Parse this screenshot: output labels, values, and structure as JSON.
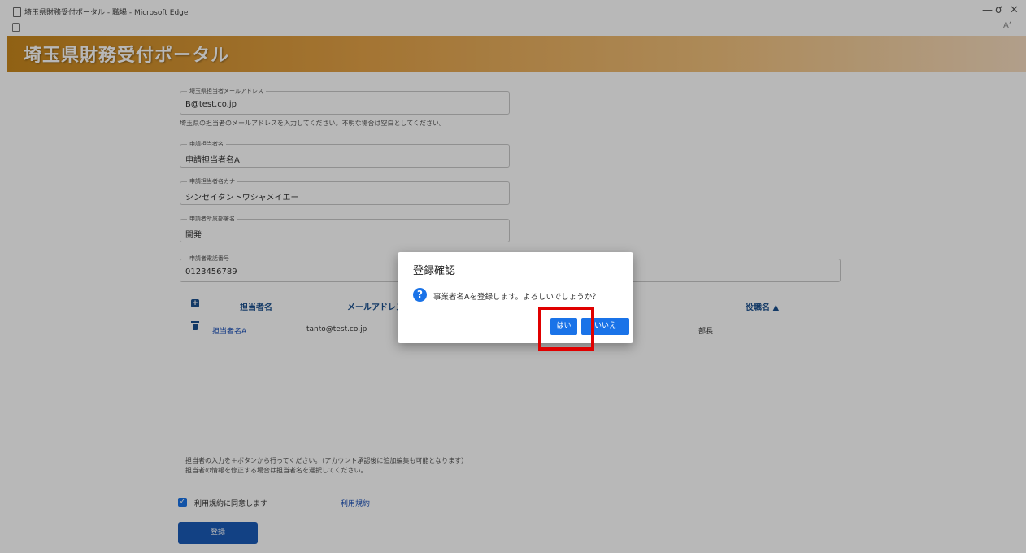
{
  "window": {
    "title": "埼玉県財務受付ポータル - 職場 - Microsoft Edge",
    "minimize": "—",
    "restore": "ơ",
    "close": "✕",
    "read_aloud": "Aʼ"
  },
  "portal": {
    "title": "埼玉県財務受付ポータル"
  },
  "form": {
    "email": {
      "label": "埼玉県担当者メールアドレス",
      "value": "B@test.co.jp"
    },
    "email_hint": "埼玉県の担当者のメールアドレスを入力してください。不明な場合は空白としてください。",
    "applicant_name": {
      "label": "申請担当者名",
      "value": "申請担当者名A"
    },
    "applicant_kana": {
      "label": "申請担当者名カナ",
      "value": "シンセイタントウシャメイエー"
    },
    "department": {
      "label": "申請者所属部署名",
      "value": "開発"
    },
    "phone": {
      "label": "申請者電話番号",
      "value": "0123456789"
    }
  },
  "table": {
    "headers": {
      "name": "担当者名",
      "email": "メールアドレス",
      "position": "役職名 ▲"
    },
    "rows": [
      {
        "name": "担当者名A",
        "email": "tanto@test.co.jp",
        "position": "部長"
      }
    ]
  },
  "hints": {
    "line1": "担当者の入力を＋ボタンから行ってください。（アカウント承認後に追加編集も可能となります）",
    "line2": "担当者の情報を修正する場合は担当者名を選択してください。"
  },
  "agree": {
    "label": "利用規約に同意します",
    "link": "利用規約"
  },
  "submit_label": "登録",
  "dialog": {
    "title": "登録確認",
    "message": "事業者名Aを登録します。よろしいでしょうか？",
    "yes": "はい",
    "no": "いいえ"
  },
  "colors": {
    "accent": "#1a73e8",
    "highlight": "#e00000",
    "banner": "#e3a247"
  }
}
